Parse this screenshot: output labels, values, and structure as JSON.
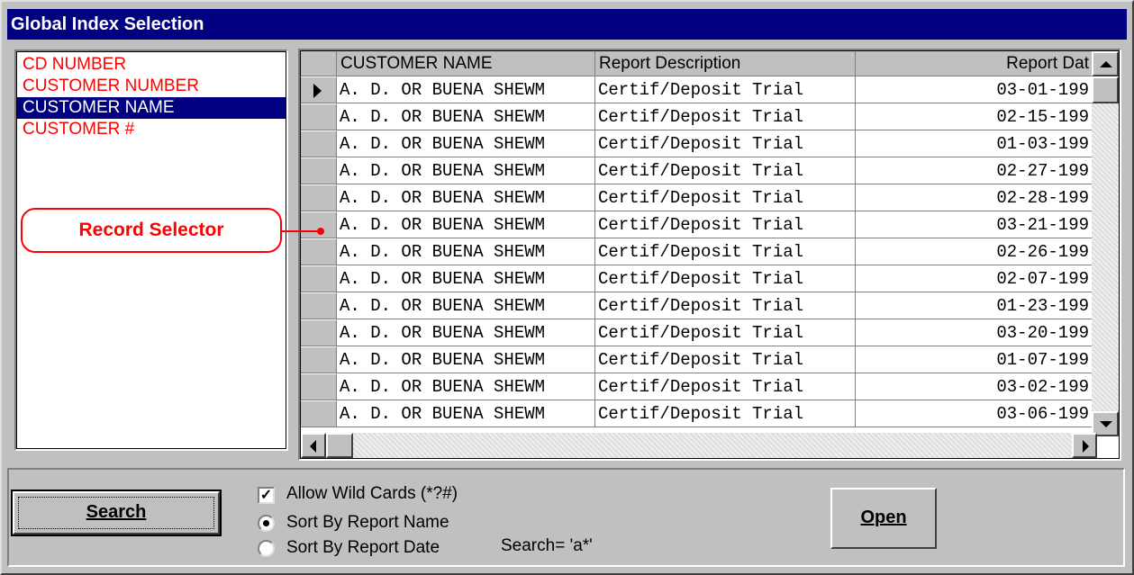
{
  "window": {
    "title": "Global Index Selection"
  },
  "index_list": {
    "items": [
      {
        "label": "CD NUMBER",
        "selected": false
      },
      {
        "label": "CUSTOMER NUMBER",
        "selected": false
      },
      {
        "label": "CUSTOMER NAME",
        "selected": true
      },
      {
        "label": "CUSTOMER #",
        "selected": false
      }
    ]
  },
  "callout": {
    "label": "Record Selector"
  },
  "grid": {
    "columns": [
      "CUSTOMER NAME",
      "Report Description",
      "Report Dat"
    ],
    "rows": [
      {
        "name": "A. D. OR BUENA SHEWM",
        "desc": "Certif/Deposit Trial",
        "date": "03-01-199"
      },
      {
        "name": "A. D. OR BUENA SHEWM",
        "desc": "Certif/Deposit Trial",
        "date": "02-15-199"
      },
      {
        "name": "A. D. OR BUENA SHEWM",
        "desc": "Certif/Deposit Trial",
        "date": "01-03-199"
      },
      {
        "name": "A. D. OR BUENA SHEWM",
        "desc": "Certif/Deposit Trial",
        "date": "02-27-199"
      },
      {
        "name": "A. D. OR BUENA SHEWM",
        "desc": "Certif/Deposit Trial",
        "date": "02-28-199"
      },
      {
        "name": "A. D. OR BUENA SHEWM",
        "desc": "Certif/Deposit Trial",
        "date": "03-21-199"
      },
      {
        "name": "A. D. OR BUENA SHEWM",
        "desc": "Certif/Deposit Trial",
        "date": "02-26-199"
      },
      {
        "name": "A. D. OR BUENA SHEWM",
        "desc": "Certif/Deposit Trial",
        "date": "02-07-199"
      },
      {
        "name": "A. D. OR BUENA SHEWM",
        "desc": "Certif/Deposit Trial",
        "date": "01-23-199"
      },
      {
        "name": "A. D. OR BUENA SHEWM",
        "desc": "Certif/Deposit Trial",
        "date": "03-20-199"
      },
      {
        "name": "A. D. OR BUENA SHEWM",
        "desc": "Certif/Deposit Trial",
        "date": "01-07-199"
      },
      {
        "name": "A. D. OR BUENA SHEWM",
        "desc": "Certif/Deposit Trial",
        "date": "03-02-199"
      },
      {
        "name": "A. D. OR BUENA SHEWM",
        "desc": "Certif/Deposit Trial",
        "date": "03-06-199"
      }
    ]
  },
  "controls": {
    "search_button": "Search",
    "open_button": "Open",
    "allow_wildcards": {
      "label": "Allow Wild Cards (*?#)",
      "checked": true
    },
    "sort_options": [
      {
        "label": "Sort By Report Name",
        "selected": true
      },
      {
        "label": "Sort By Report Date",
        "selected": false
      }
    ],
    "search_status": "Search= 'a*'"
  },
  "colors": {
    "title_bar": "#000080",
    "index_text": "#ff0000",
    "callout": "#ff0000",
    "face": "#c0c0c0"
  }
}
